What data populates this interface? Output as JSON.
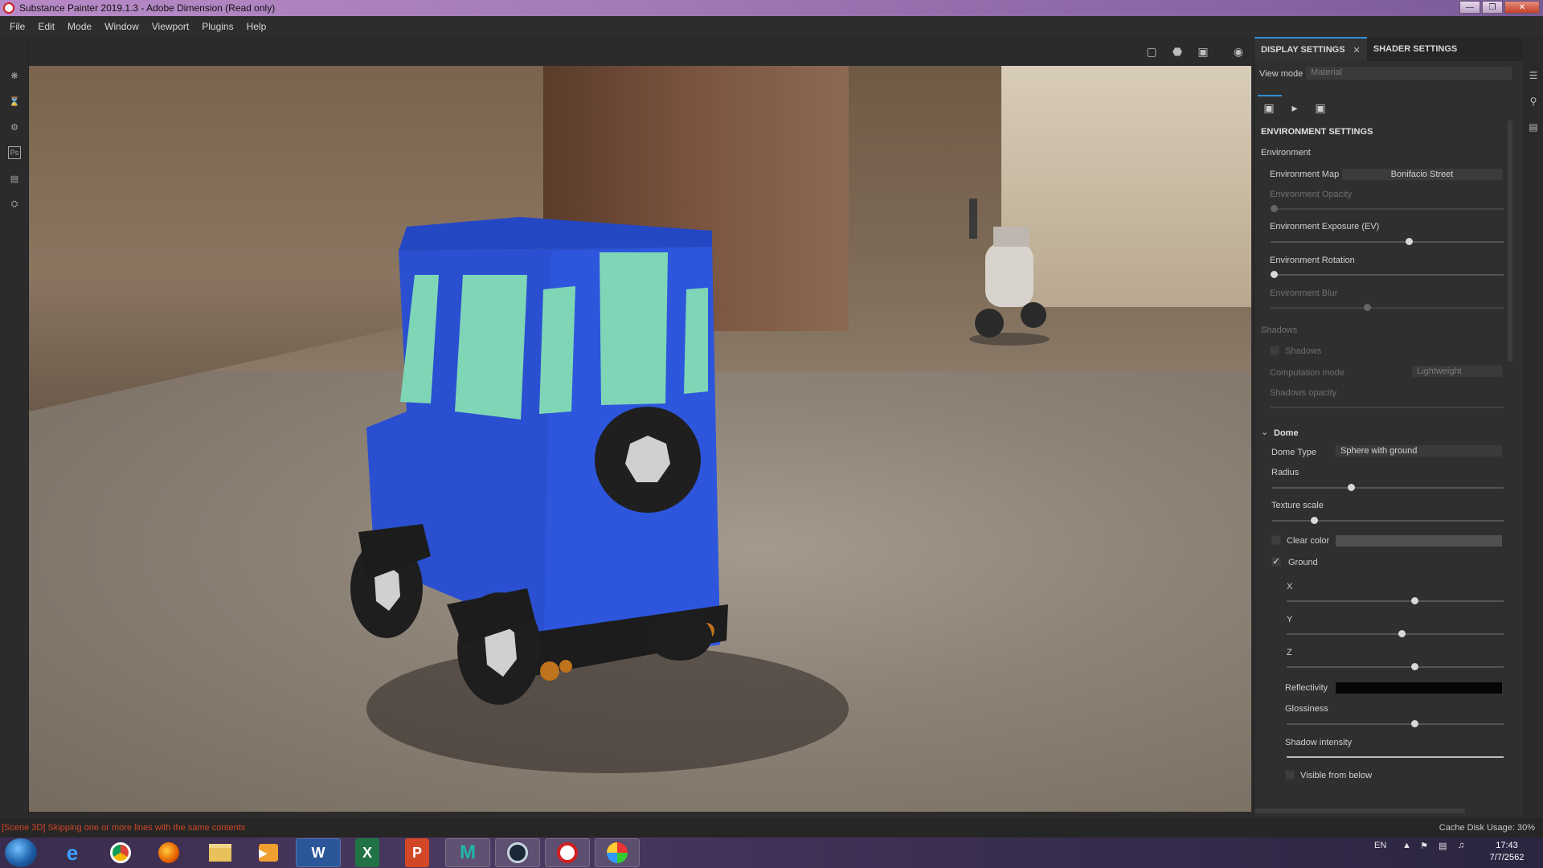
{
  "window": {
    "title": "Substance Painter 2019.1.3 - Adobe Dimension (Read only)",
    "controls": [
      "minimize-icon",
      "maximize-icon",
      "close-icon"
    ]
  },
  "menu": [
    "File",
    "Edit",
    "Mode",
    "Window",
    "Viewport",
    "Plugins",
    "Help"
  ],
  "viewport_toolbar": [
    "frame-icon",
    "cube-icon",
    "camera-icon",
    "screenshot-icon"
  ],
  "left_tools": [
    "substance-icon",
    "hourglass-icon",
    "gear-icon",
    "photoshop-icon",
    "document-icon",
    "settings-icon"
  ],
  "panel": {
    "tabs": [
      {
        "label": "DISPLAY SETTINGS",
        "active": true,
        "closable": true
      },
      {
        "label": "SHADER SETTINGS",
        "active": false
      }
    ],
    "view_mode_label": "View mode",
    "view_mode_value": "Material",
    "subtabs": [
      "image-icon",
      "video-camera-icon",
      "frame-icon"
    ],
    "env_settings_title": "ENVIRONMENT SETTINGS",
    "environment_label": "Environment",
    "environment_map_label": "Environment Map",
    "environment_map_value": "Bonifacio Street",
    "sliders": [
      {
        "label": "Environment Opacity",
        "value": 0.0,
        "enabled": false
      },
      {
        "label": "Environment Exposure (EV)",
        "value": 0.59,
        "enabled": true
      },
      {
        "label": "Environment Rotation",
        "value": 0.0,
        "enabled": true
      },
      {
        "label": "Environment Blur",
        "value": 0.4,
        "enabled": false
      }
    ],
    "shadows_section": "Shadows",
    "shadows_checkbox": "Shadows",
    "computation_mode_label": "Computation mode",
    "computation_mode_value": "Lightweight",
    "shadows_opacity_label": "Shadows opacity",
    "dome": {
      "title": "Dome",
      "dome_type_label": "Dome Type",
      "dome_type_value": "Sphere with ground",
      "radius_label": "Radius",
      "radius_value": 0.33,
      "texture_scale_label": "Texture scale",
      "texture_scale_value": 0.17,
      "clear_color_label": "Clear color",
      "ground_label": "Ground",
      "ground_checked": true,
      "x_label": "X",
      "x_value": 0.59,
      "y_label": "Y",
      "y_value": 0.53,
      "z_label": "Z",
      "z_value": 0.59,
      "reflectivity_label": "Reflectivity",
      "glossiness_label": "Glossiness",
      "glossiness_value": 0.59,
      "shadow_intensity_label": "Shadow intensity",
      "visible_from_below_label": "Visible from below"
    }
  },
  "right_strip": [
    "layers-icon",
    "magnifier-icon",
    "properties-icon"
  ],
  "status": {
    "log": "[Scene 3D] Skipping one or more lines with the same contents",
    "cache": "Cache Disk Usage:   30%"
  },
  "taskbar": {
    "apps": [
      "start-button",
      "ie-icon",
      "chrome-icon",
      "firefox-icon",
      "explorer-icon",
      "media-player-icon",
      "word-icon",
      "excel-icon",
      "powerpoint-icon",
      "maya-icon",
      "steam-icon",
      "substance-painter-icon",
      "paint-icon"
    ],
    "language": "EN",
    "time": "17:43",
    "date": "7/7/2562"
  },
  "colors": {
    "accent": "#2f8ed4",
    "jeep_body": "#2a4fd0",
    "jeep_glass": "#7fd6b7",
    "error_text": "#d0452b"
  }
}
